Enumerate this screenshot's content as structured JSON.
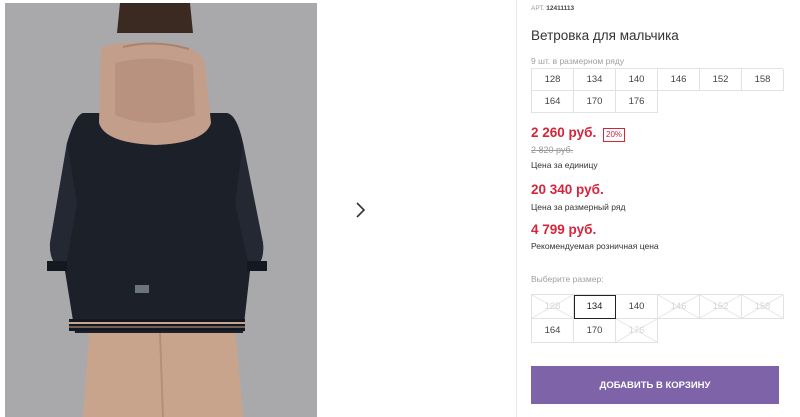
{
  "gallery": {
    "photo_alt": "boy-windbreaker-back-view",
    "next_icon": "chevron-right-icon"
  },
  "product": {
    "article_label": "АРТ.",
    "article_value": "12411113",
    "title": "Ветровка для мальчика",
    "row_caption": "9 шт. в размерном ряду",
    "row_sizes": [
      "128",
      "134",
      "140",
      "146",
      "152",
      "158",
      "164",
      "170",
      "176"
    ]
  },
  "prices": {
    "unit_price": "2 260 руб.",
    "discount": "20%",
    "old_price": "2 820 руб.",
    "unit_note": "Цена за единицу",
    "row_price": "20 340 руб.",
    "row_note": "Цена за размерный ряд",
    "retail_price": "4 799 руб.",
    "retail_note": "Рекомендуемая розничная цена"
  },
  "size_selector": {
    "label": "Выберите размер:",
    "sizes": [
      {
        "label": "128",
        "available": false
      },
      {
        "label": "134",
        "available": true,
        "selected": true
      },
      {
        "label": "140",
        "available": true
      },
      {
        "label": "146",
        "available": false
      },
      {
        "label": "152",
        "available": false
      },
      {
        "label": "158",
        "available": false
      },
      {
        "label": "164",
        "available": true
      },
      {
        "label": "170",
        "available": true
      },
      {
        "label": "176",
        "available": false
      }
    ]
  },
  "actions": {
    "add_to_cart": "Добавить в корзину"
  },
  "colors": {
    "price_red": "#d6243a",
    "button_purple": "#7f63a9"
  }
}
